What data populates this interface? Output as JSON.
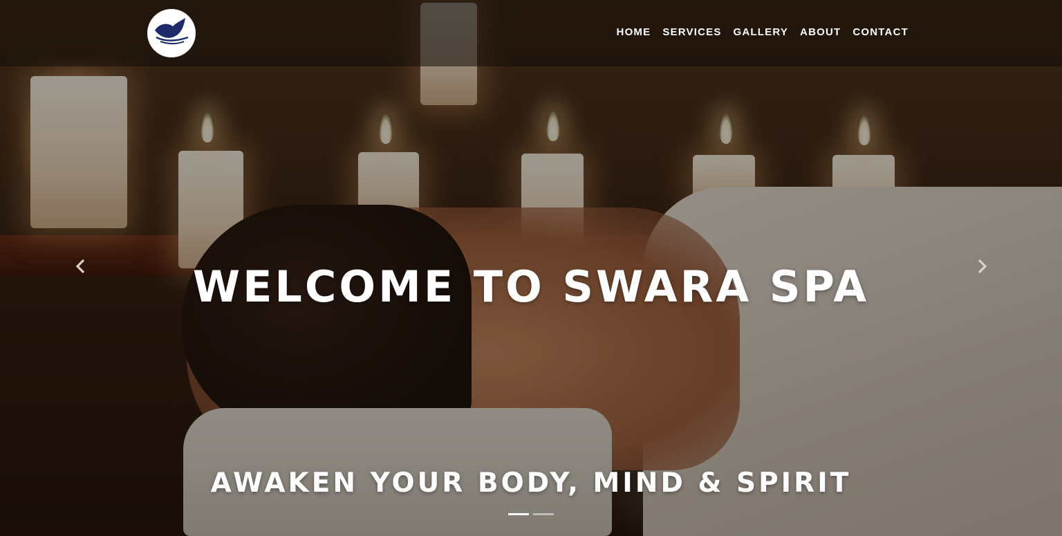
{
  "brand": {
    "logo_icon": "feather-leaf-icon",
    "logo_color": "#1f2a6b"
  },
  "nav": {
    "items": [
      {
        "label": "HOME"
      },
      {
        "label": "SERVICES"
      },
      {
        "label": "GALLERY"
      },
      {
        "label": "ABOUT"
      },
      {
        "label": "CONTACT"
      }
    ]
  },
  "hero": {
    "title": "WELCOME TO SWARA SPA",
    "subtitle": "AWAKEN YOUR BODY, MIND & SPIRIT",
    "prev_icon": "chevron-left-icon",
    "next_icon": "chevron-right-icon",
    "slides_total": 2,
    "active_slide": 1
  },
  "colors": {
    "nav_text": "#ffffff",
    "heading_text": "#ffffff",
    "logo_background": "#ffffff"
  }
}
